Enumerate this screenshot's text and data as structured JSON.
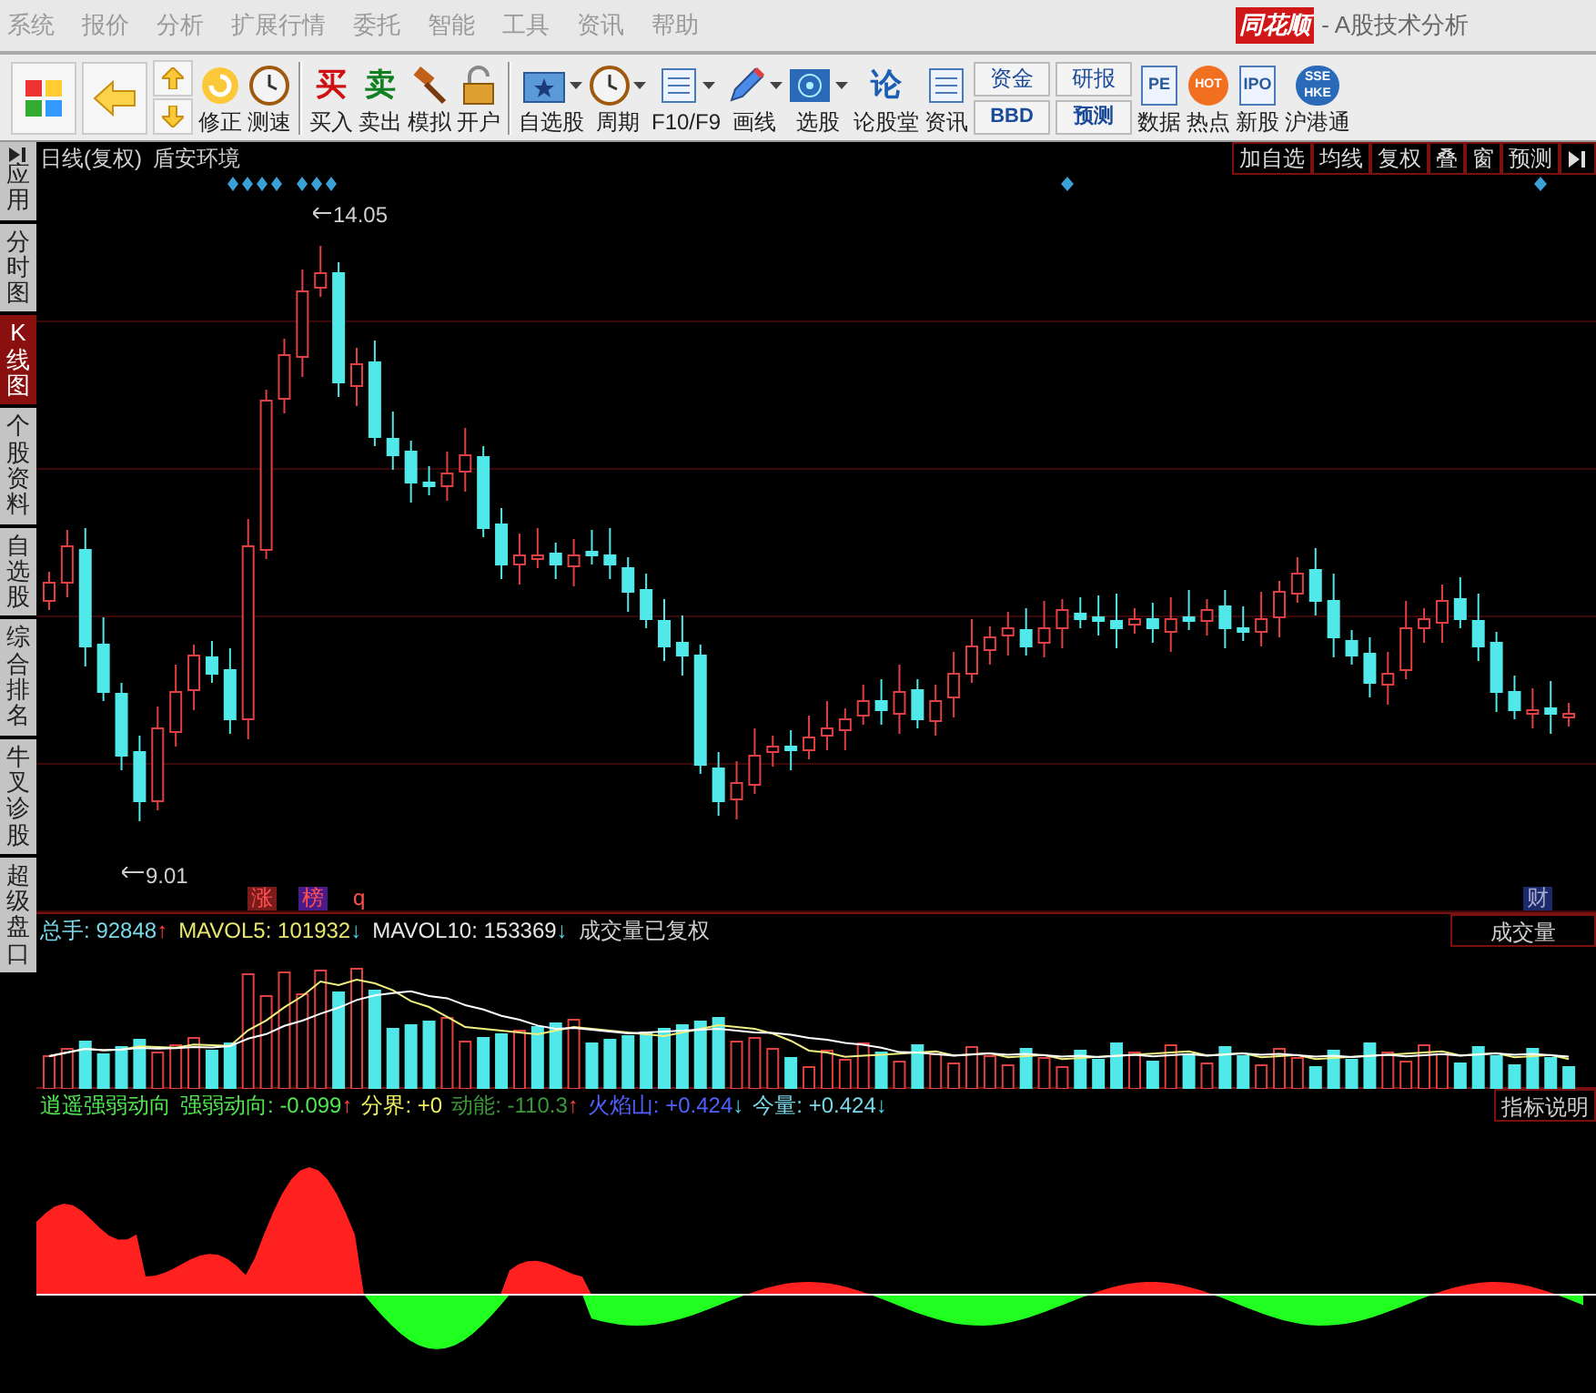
{
  "menu": [
    "系统",
    "报价",
    "分析",
    "扩展行情",
    "委托",
    "智能",
    "工具",
    "资讯",
    "帮助"
  ],
  "app_title": {
    "brand": "同花顺",
    "subtitle": "- A股技术分析"
  },
  "toolbar": [
    {
      "kind": "grid"
    },
    {
      "kind": "back"
    },
    {
      "kind": "updown"
    },
    {
      "kind": "refresh",
      "label": "修正"
    },
    {
      "kind": "clock",
      "label": "测速"
    },
    {
      "kind": "sep"
    },
    {
      "kind": "glyph",
      "glyph": "买",
      "color": "#d01010",
      "label": "买入"
    },
    {
      "kind": "glyph",
      "glyph": "卖",
      "color": "#108020",
      "label": "卖出"
    },
    {
      "kind": "hammer",
      "label": "模拟"
    },
    {
      "kind": "lock",
      "label": "开户"
    },
    {
      "kind": "sep"
    },
    {
      "kind": "folder",
      "label": "自选股",
      "dropdown": true
    },
    {
      "kind": "clock",
      "label": "周期",
      "dropdown": true
    },
    {
      "kind": "doc",
      "label": "F10/F9",
      "dropdown": true
    },
    {
      "kind": "pencil",
      "label": "画线",
      "dropdown": true
    },
    {
      "kind": "radar",
      "label": "选股",
      "dropdown": true
    },
    {
      "kind": "glyph",
      "glyph": "论",
      "color": "#1a5fb4",
      "label": "论股堂"
    },
    {
      "kind": "doc",
      "label": "资讯"
    },
    {
      "kind": "pair",
      "top": "资金",
      "bottom": "BBD"
    },
    {
      "kind": "pair",
      "top": "研报",
      "bottom": "预测"
    },
    {
      "kind": "tag",
      "glyph": "PE",
      "label": "数据"
    },
    {
      "kind": "fire",
      "glyph": "HOT",
      "label": "热点"
    },
    {
      "kind": "tag",
      "glyph": "IPO",
      "label": "新股"
    },
    {
      "kind": "globe",
      "glyph": "SSE HKE",
      "label": "沪港通"
    }
  ],
  "sidebar": [
    {
      "label": "应用",
      "selected": false,
      "icon": true
    },
    {
      "label": "分时图",
      "selected": false
    },
    {
      "label": "K线图",
      "selected": true
    },
    {
      "label": "个股资料",
      "selected": false
    },
    {
      "label": "自选股",
      "selected": false
    },
    {
      "label": "综合排名",
      "selected": false
    },
    {
      "label": "牛叉诊股",
      "selected": false
    },
    {
      "label": "超级盘口",
      "selected": false
    }
  ],
  "chart_header": {
    "period": "日线(复权)",
    "stock": "盾安环境",
    "buttons": [
      "加自选",
      "均线",
      "复权",
      "叠",
      "窗",
      "预测"
    ]
  },
  "kline": {
    "high_label": "14.05",
    "low_label": "9.01",
    "markers": [
      {
        "text": "涨",
        "color": "#7a1a1a"
      },
      {
        "text": "榜",
        "color": "#4a1a8a"
      },
      {
        "text": "q",
        "color": "#000000"
      }
    ],
    "right_marker": "财"
  },
  "volume": {
    "items": [
      {
        "label": "总手:",
        "value": "92848",
        "arrow": "↑",
        "color": "#7ad8e8"
      },
      {
        "label": "MAVOL5:",
        "value": "101932",
        "arrow": "↓",
        "color": "#e8e870"
      },
      {
        "label": "MAVOL10:",
        "value": "153369",
        "arrow": "↓",
        "color": "#e8e8e8"
      }
    ],
    "note": "成交量已复权",
    "selector": "成交量"
  },
  "indicator": {
    "name": "逍遥强弱动向",
    "items": [
      {
        "label": "强弱动向:",
        "value": "-0.099",
        "arrow": "↑",
        "color": "#50e850"
      },
      {
        "label": "分界:",
        "value": "+0",
        "color": "#f0f060"
      },
      {
        "label": "动能:",
        "value": "-110.3",
        "arrow": "↑",
        "color": "#3a9a3a"
      },
      {
        "label": "火焰山:",
        "value": "+0.424",
        "arrow": "↓",
        "color": "#5060ff"
      },
      {
        "label": "今量:",
        "value": "+0.424",
        "arrow": "↓",
        "color": "#7ad8e8"
      }
    ],
    "explain": "指标说明"
  }
}
